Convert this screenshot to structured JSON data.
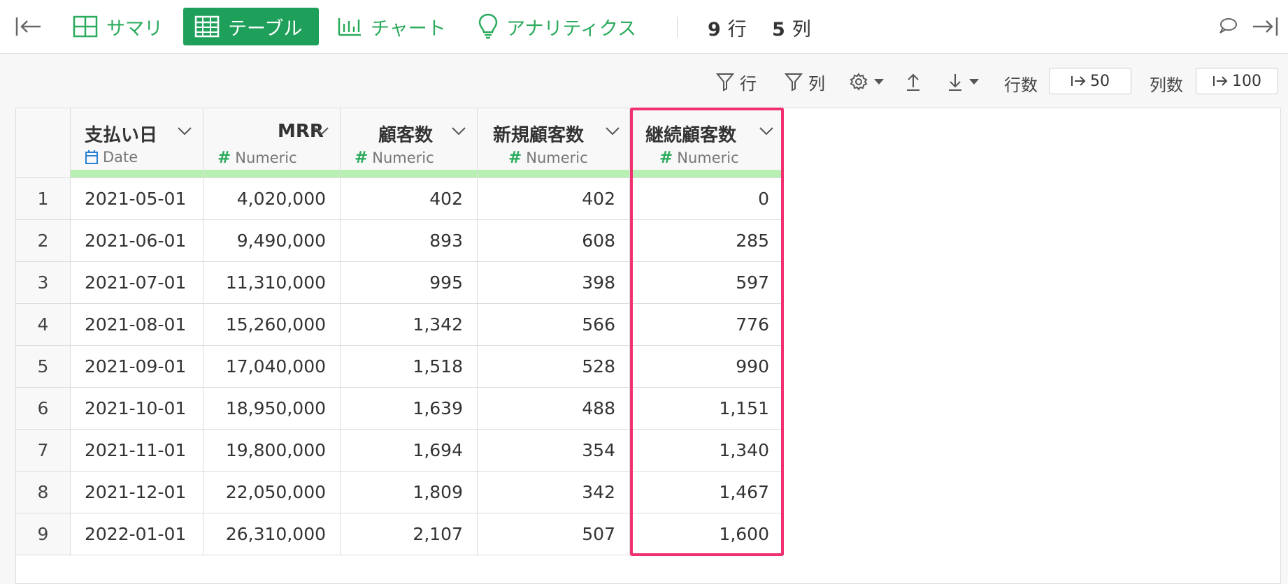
{
  "nav": {
    "tabs": [
      {
        "label": "サマリ",
        "icon": "grid-icon"
      },
      {
        "label": "テーブル",
        "icon": "table-icon",
        "active": true
      },
      {
        "label": "チャート",
        "icon": "bar-chart-icon"
      },
      {
        "label": "アナリティクス",
        "icon": "lightbulb-icon"
      }
    ],
    "rows_count": "9",
    "rows_unit": "行",
    "cols_count": "5",
    "cols_unit": "列"
  },
  "toolbar": {
    "filter_rows_label": "行",
    "filter_cols_label": "列",
    "rows_limit_label": "行数",
    "rows_limit_value": "50",
    "cols_limit_label": "列数",
    "cols_limit_value": "100"
  },
  "table": {
    "columns": [
      {
        "name": "支払い日",
        "type": "Date"
      },
      {
        "name": "MRR",
        "type": "Numeric"
      },
      {
        "name": "顧客数",
        "type": "Numeric"
      },
      {
        "name": "新規顧客数",
        "type": "Numeric"
      },
      {
        "name": "継続顧客数",
        "type": "Numeric"
      }
    ],
    "rows": [
      {
        "idx": "1",
        "cells": [
          "2021-05-01",
          "4,020,000",
          "402",
          "402",
          "0"
        ]
      },
      {
        "idx": "2",
        "cells": [
          "2021-06-01",
          "9,490,000",
          "893",
          "608",
          "285"
        ]
      },
      {
        "idx": "3",
        "cells": [
          "2021-07-01",
          "11,310,000",
          "995",
          "398",
          "597"
        ]
      },
      {
        "idx": "4",
        "cells": [
          "2021-08-01",
          "15,260,000",
          "1,342",
          "566",
          "776"
        ]
      },
      {
        "idx": "5",
        "cells": [
          "2021-09-01",
          "17,040,000",
          "1,518",
          "528",
          "990"
        ]
      },
      {
        "idx": "6",
        "cells": [
          "2021-10-01",
          "18,950,000",
          "1,639",
          "488",
          "1,151"
        ]
      },
      {
        "idx": "7",
        "cells": [
          "2021-11-01",
          "19,800,000",
          "1,694",
          "354",
          "1,340"
        ]
      },
      {
        "idx": "8",
        "cells": [
          "2021-12-01",
          "22,050,000",
          "1,809",
          "342",
          "1,467"
        ]
      },
      {
        "idx": "9",
        "cells": [
          "2022-01-01",
          "26,310,000",
          "2,107",
          "507",
          "1,600"
        ]
      }
    ],
    "highlighted_column": "継続顧客数"
  },
  "colors": {
    "accent": "#2bab5c",
    "accent_active": "#1fa05a",
    "column_bar": "#b8f0b4",
    "highlight": "#f0306f"
  }
}
